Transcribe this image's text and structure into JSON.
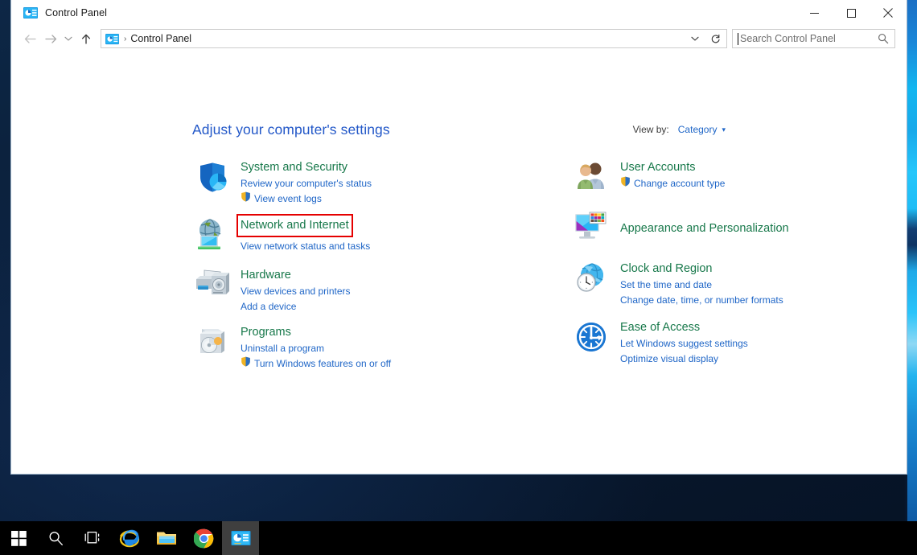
{
  "window": {
    "title": "Control Panel",
    "title_icon": "control-panel-icon",
    "controls": {
      "minimize": "minimize-icon",
      "maximize": "maximize-icon",
      "close": "close-icon"
    }
  },
  "addressbar": {
    "back": "back-arrow-icon",
    "forward": "forward-arrow-icon",
    "recent": "chevron-down-icon",
    "up": "up-arrow-icon",
    "breadcrumb_icon": "control-panel-icon",
    "breadcrumb_separator": "›",
    "breadcrumb_text": "Control Panel",
    "dropdown": "chevron-down-icon",
    "refresh": "refresh-icon",
    "search_placeholder": "Search Control Panel",
    "search_value": "",
    "search_icon": "search-icon"
  },
  "content": {
    "heading": "Adjust your computer's settings",
    "viewby_label": "View by:",
    "viewby_value": "Category",
    "viewby_caret": "▾"
  },
  "colors": {
    "heading": "#2358c8",
    "category_title": "#17784a",
    "link": "#1f66c7",
    "highlight": "#e50000",
    "taskbar": "#000000"
  },
  "categories": {
    "left": [
      {
        "title": "System and Security",
        "icon": "shield-security-icon",
        "highlighted": false,
        "links": [
          {
            "text": "Review your computer's status",
            "uac": false
          },
          {
            "text": "View event logs",
            "uac": true
          }
        ]
      },
      {
        "title": "Network and Internet",
        "icon": "globe-network-icon",
        "highlighted": true,
        "links": [
          {
            "text": "View network status and tasks",
            "uac": false
          }
        ]
      },
      {
        "title": "Hardware",
        "icon": "printer-hardware-icon",
        "highlighted": false,
        "links": [
          {
            "text": "View devices and printers",
            "uac": false
          },
          {
            "text": "Add a device",
            "uac": false
          }
        ]
      },
      {
        "title": "Programs",
        "icon": "programs-disc-icon",
        "highlighted": false,
        "links": [
          {
            "text": "Uninstall a program",
            "uac": false
          },
          {
            "text": "Turn Windows features on or off",
            "uac": true
          }
        ]
      }
    ],
    "right": [
      {
        "title": "User Accounts",
        "icon": "user-accounts-icon",
        "highlighted": false,
        "links": [
          {
            "text": "Change account type",
            "uac": true
          }
        ]
      },
      {
        "title": "Appearance and Personalization",
        "icon": "appearance-monitor-icon",
        "highlighted": false,
        "links": []
      },
      {
        "title": "Clock and Region",
        "icon": "clock-region-icon",
        "highlighted": false,
        "links": [
          {
            "text": "Set the time and date",
            "uac": false
          },
          {
            "text": "Change date, time, or number formats",
            "uac": false
          }
        ]
      },
      {
        "title": "Ease of Access",
        "icon": "ease-of-access-icon",
        "highlighted": false,
        "links": [
          {
            "text": "Let Windows suggest settings",
            "uac": false
          },
          {
            "text": "Optimize visual display",
            "uac": false
          }
        ]
      }
    ]
  },
  "taskbar": {
    "items": [
      {
        "name": "start-button",
        "icon": "windows-logo-icon",
        "active": false
      },
      {
        "name": "search-button",
        "icon": "search-icon",
        "active": false
      },
      {
        "name": "task-view-button",
        "icon": "task-view-icon",
        "active": false
      },
      {
        "name": "internet-explorer-button",
        "icon": "internet-explorer-icon",
        "active": false
      },
      {
        "name": "file-explorer-button",
        "icon": "file-explorer-icon",
        "active": false
      },
      {
        "name": "chrome-button",
        "icon": "chrome-icon",
        "active": false
      },
      {
        "name": "control-panel-button",
        "icon": "control-panel-icon",
        "active": true
      }
    ]
  }
}
